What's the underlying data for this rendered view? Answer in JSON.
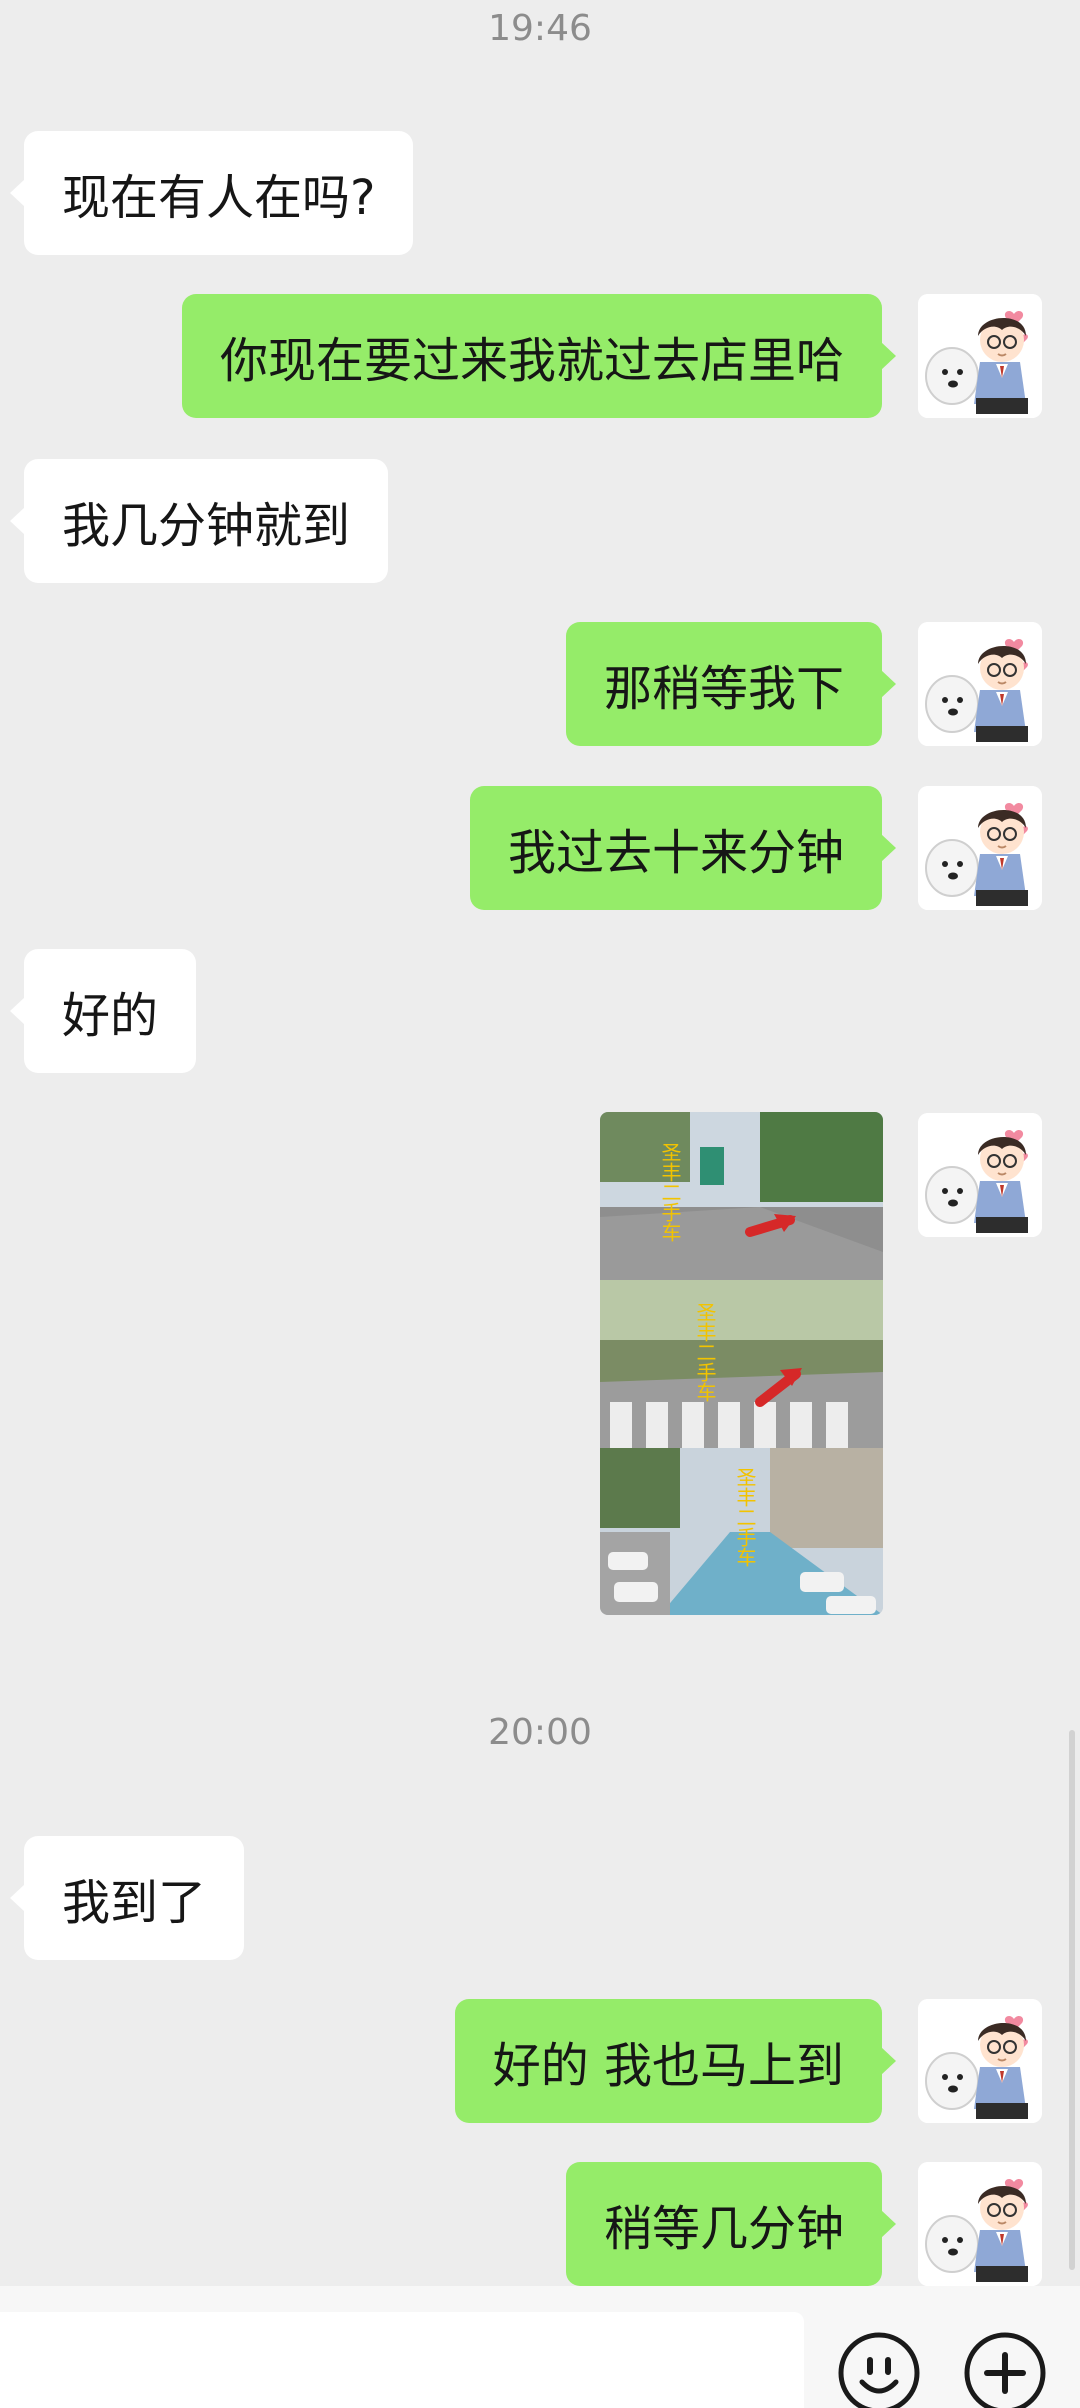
{
  "chat": {
    "timestamps": [
      "19:46",
      "20:00"
    ],
    "messages": [
      {
        "from": "other",
        "type": "text",
        "text": "现在有人在吗?"
      },
      {
        "from": "me",
        "type": "text",
        "text": "你现在要过来我就过去店里哈"
      },
      {
        "from": "other",
        "type": "text",
        "text": "我几分钟就到"
      },
      {
        "from": "me",
        "type": "text",
        "text": "那稍等我下"
      },
      {
        "from": "me",
        "type": "text",
        "text": "我过去十来分钟"
      },
      {
        "from": "other",
        "type": "text",
        "text": "好的"
      },
      {
        "from": "me",
        "type": "image",
        "overlay_text": "圣丰二手车",
        "panels": 3,
        "icon": "photo-route-arrows"
      },
      {
        "from": "other",
        "type": "text",
        "text": "我到了"
      },
      {
        "from": "me",
        "type": "text",
        "text": "好的 我也马上到"
      },
      {
        "from": "me",
        "type": "text",
        "text": "稍等几分钟"
      }
    ]
  },
  "input_bar": {
    "emoji_icon": "smiley-icon",
    "more_icon": "plus-icon"
  },
  "colors": {
    "background": "#ededed",
    "sent_bubble": "#95ec69",
    "received_bubble": "#ffffff",
    "timestamp_text": "#8c8c8c"
  }
}
